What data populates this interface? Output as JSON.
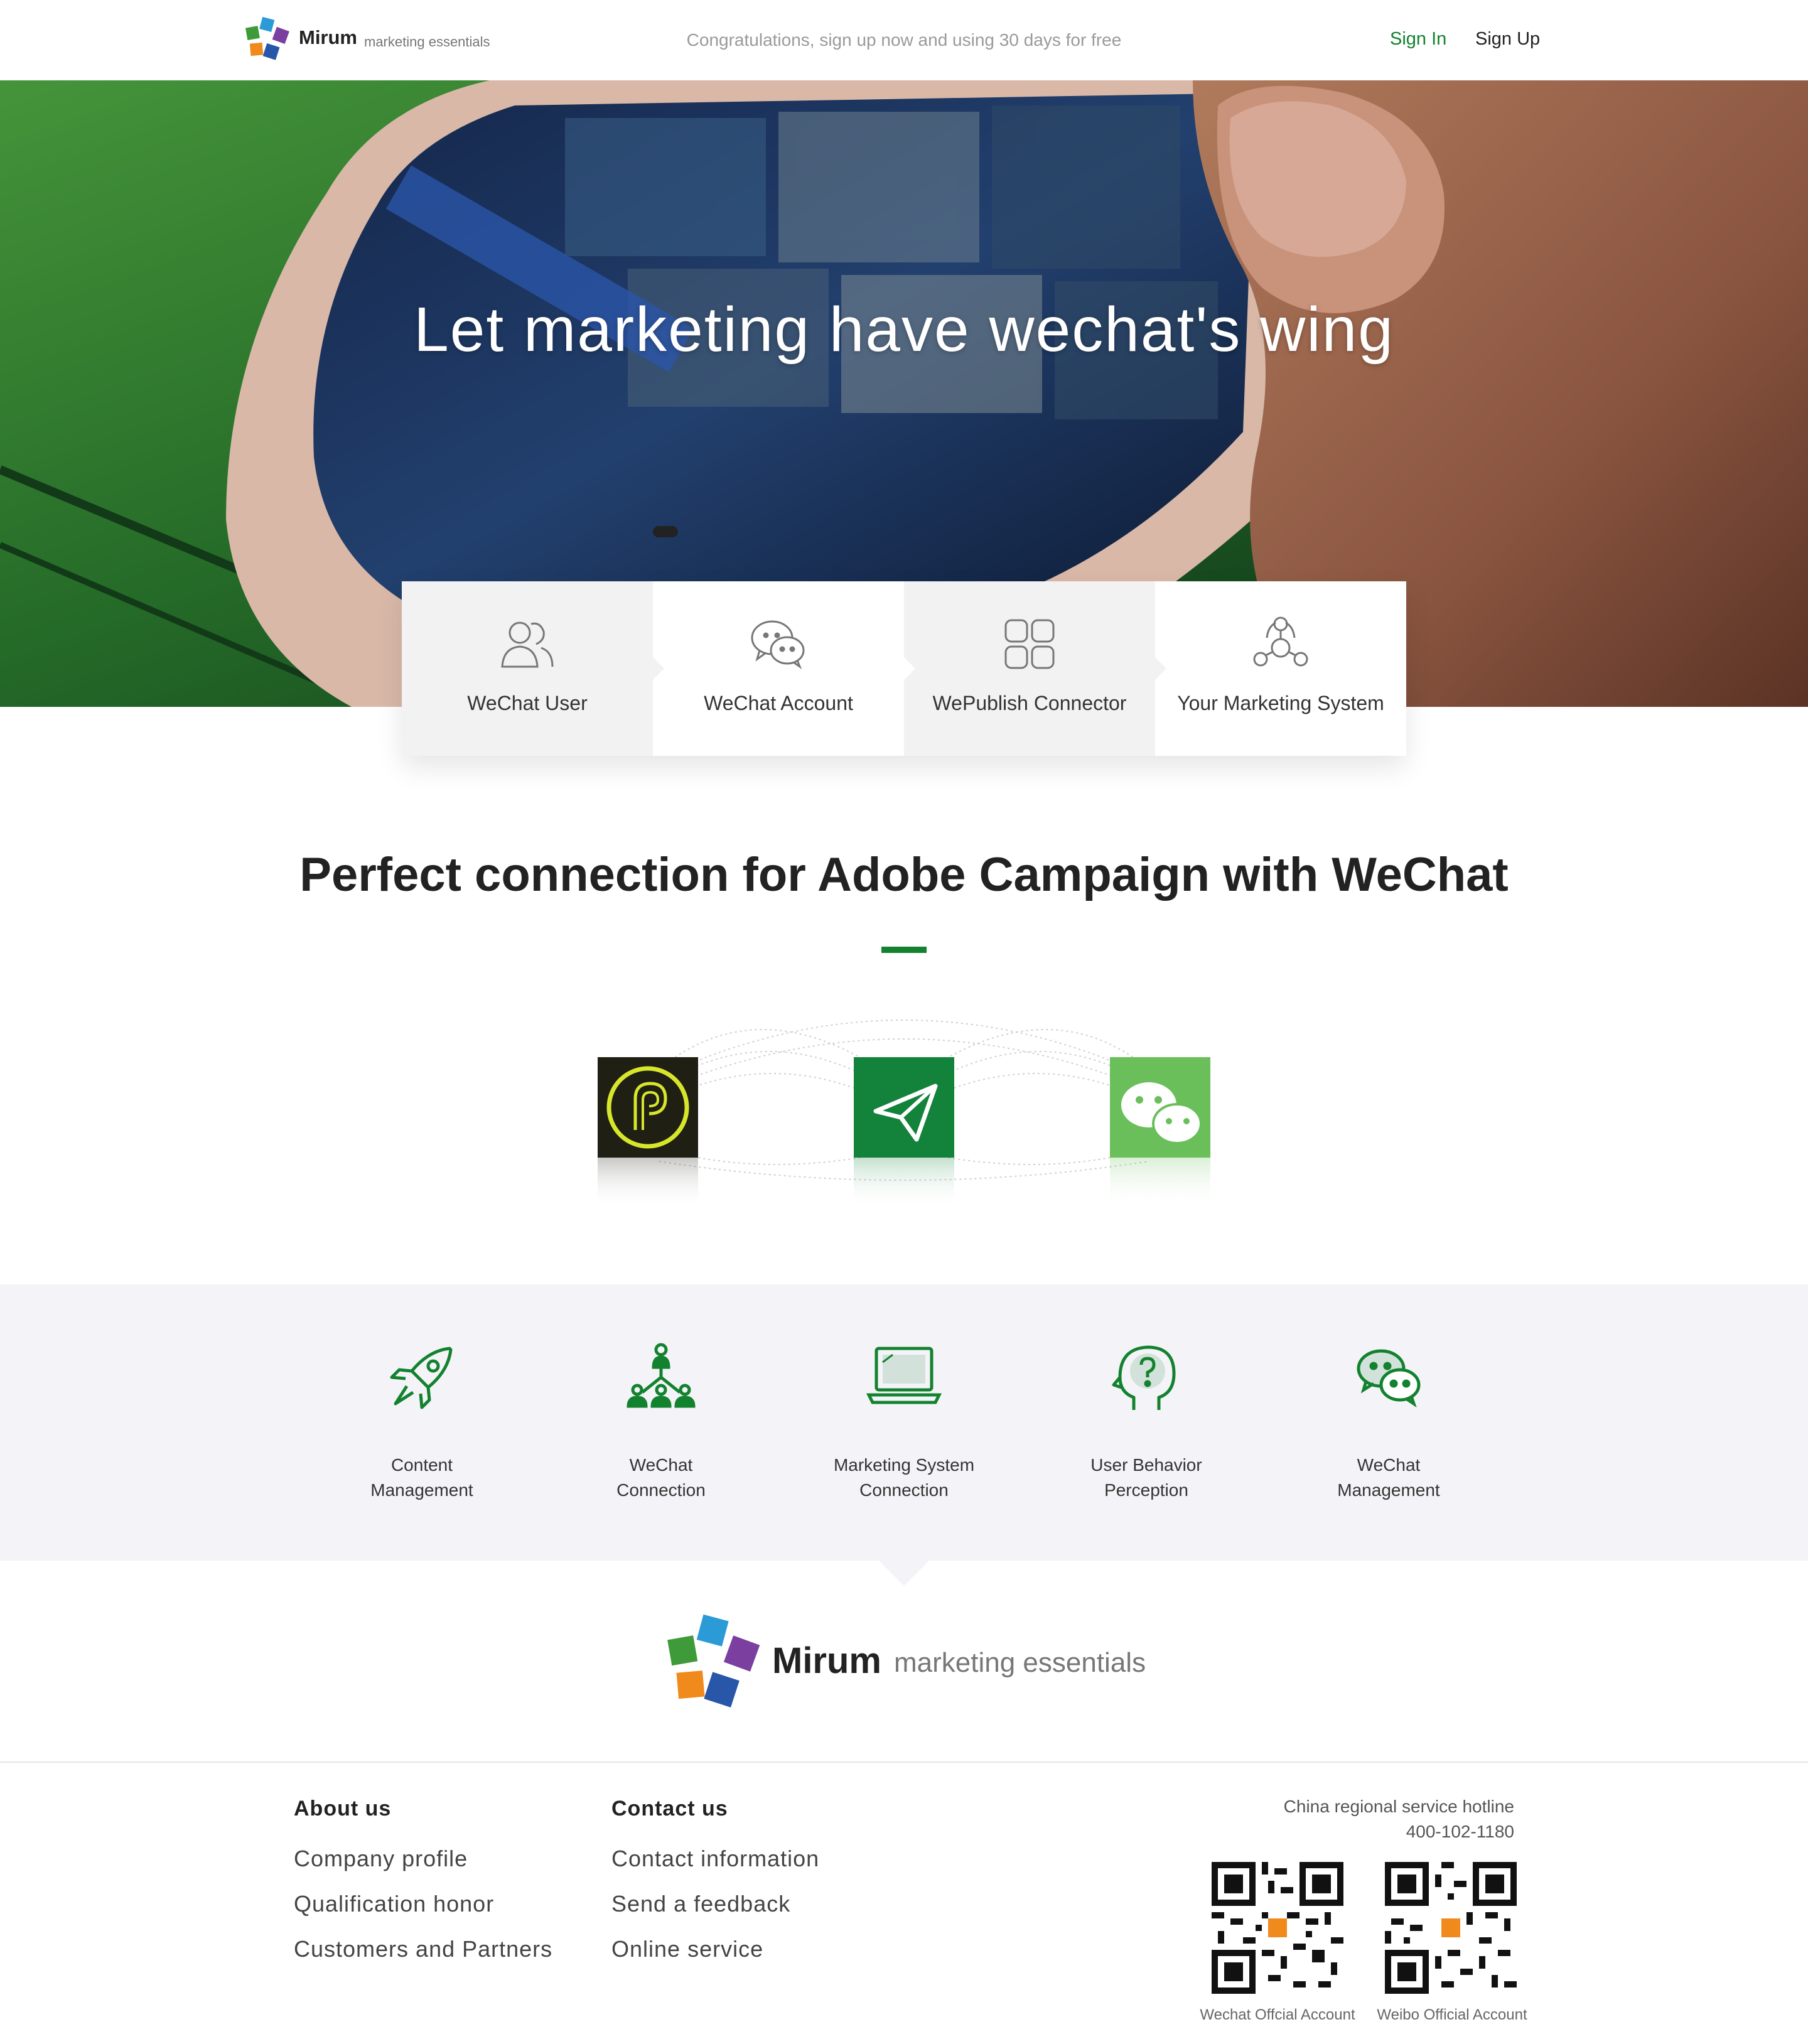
{
  "header": {
    "brand": "Mirum",
    "brand_sub": "marketing essentials",
    "promo": "Congratulations, sign up now and using 30 days for free",
    "signin": "Sign In",
    "signup": "Sign Up"
  },
  "hero": {
    "title": "Let marketing have wechat's wing"
  },
  "flow": [
    {
      "label": "WeChat User",
      "icon": "users-icon"
    },
    {
      "label": "WeChat Account",
      "icon": "wechat-chat-icon"
    },
    {
      "label": "WePublish Connector",
      "icon": "grid-icon"
    },
    {
      "label": "Your Marketing System",
      "icon": "network-icon"
    }
  ],
  "section": {
    "title": "Perfect connection for Adobe Campaign with WeChat"
  },
  "features": [
    {
      "line1": "Content",
      "line2": "Management",
      "icon": "rocket-icon"
    },
    {
      "line1": "WeChat",
      "line2": "Connection",
      "icon": "org-chart-icon"
    },
    {
      "line1": "Marketing System",
      "line2": "Connection",
      "icon": "laptop-icon"
    },
    {
      "line1": "User Behavior",
      "line2": "Perception",
      "icon": "head-question-icon"
    },
    {
      "line1": "WeChat",
      "line2": "Management",
      "icon": "wechat-icon"
    }
  ],
  "footer_brand": {
    "brand": "Mirum",
    "brand_sub": "marketing essentials"
  },
  "footer": {
    "about_title": "About us",
    "about_links": [
      "Company profile",
      "Qualification honor",
      "Customers and Partners"
    ],
    "contact_title": "Contact us",
    "contact_links": [
      "Contact information",
      "Send a feedback",
      "Online service"
    ],
    "hotline_label": "China regional service hotline",
    "hotline_number": "400-102-1180",
    "qr_wechat_caption": "Wechat Offcial Account",
    "qr_weibo_caption": "Weibo Official Account"
  },
  "colors": {
    "accent": "#13822f",
    "wechat_green": "#5cb85c",
    "features_bg": "#f4f4f8"
  }
}
